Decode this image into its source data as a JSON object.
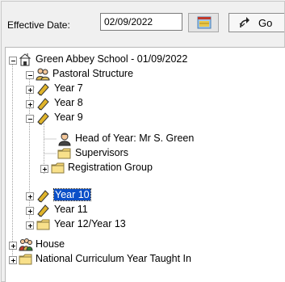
{
  "toolbar": {
    "effective_date_label": "Effective Date:",
    "effective_date_value": "02/09/2022",
    "calendar_icon": "calendar-icon",
    "go_label": "Go",
    "go_icon": "refresh-arrow-icon"
  },
  "tree": {
    "root": {
      "label": "Green Abbey School - 01/09/2022",
      "icon": "school-icon",
      "expanded": true
    },
    "pastoral": {
      "label": "Pastoral Structure",
      "icon": "group-icon",
      "expanded": true
    },
    "year7": {
      "label": "Year  7",
      "icon": "pencil-icon",
      "expanded": false
    },
    "year8": {
      "label": "Year  8",
      "icon": "pencil-icon",
      "expanded": false
    },
    "year9": {
      "label": "Year  9",
      "icon": "pencil-icon",
      "expanded": true
    },
    "head_of_year": {
      "label": "Head of Year: Mr S. Green",
      "icon": "person-icon"
    },
    "supervisors": {
      "label": "Supervisors",
      "icon": "folder-icon"
    },
    "registration_group": {
      "label": "Registration Group",
      "icon": "folder-icon",
      "expanded": false
    },
    "year10": {
      "label": "Year 10",
      "icon": "pencil-icon",
      "expanded": false,
      "selected": true
    },
    "year11": {
      "label": "Year 11",
      "icon": "pencil-icon",
      "expanded": false
    },
    "year12_13": {
      "label": "Year 12/Year 13",
      "icon": "folder-icon",
      "expanded": false
    },
    "house": {
      "label": "House",
      "icon": "group-icon",
      "expanded": false
    },
    "national_curriculum": {
      "label": "National Curriculum Year Taught In",
      "icon": "folder-icon",
      "expanded": false
    }
  },
  "colors": {
    "selection": "#0a4fc8",
    "folder": "#f5d674",
    "pencil": "#d9a520"
  }
}
